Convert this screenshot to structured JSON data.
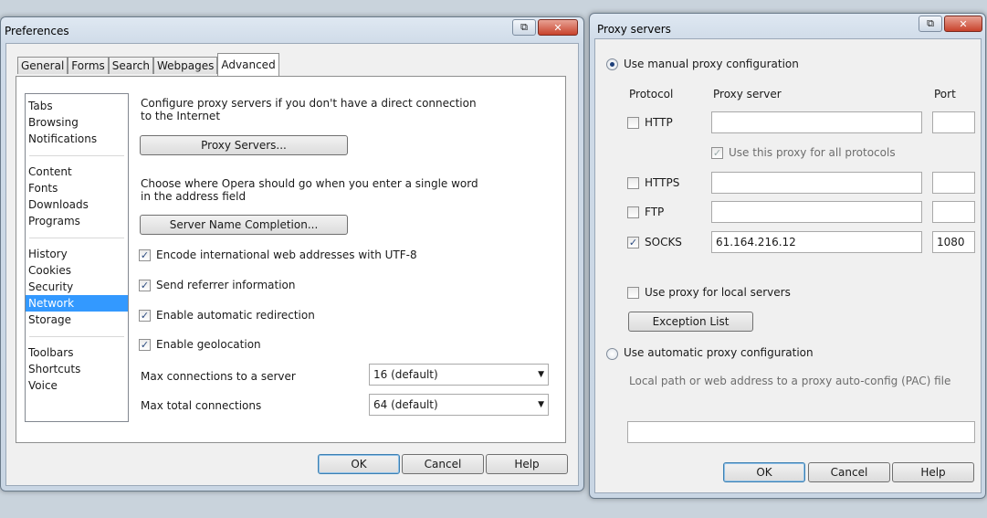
{
  "preferences": {
    "title": "Preferences",
    "tabs": [
      "General",
      "Forms",
      "Search",
      "Webpages",
      "Advanced"
    ],
    "active_tab": "Advanced",
    "categories": [
      [
        "Tabs",
        "Browsing",
        "Notifications"
      ],
      [
        "Content",
        "Fonts",
        "Downloads",
        "Programs"
      ],
      [
        "History",
        "Cookies",
        "Security",
        "Network",
        "Storage"
      ],
      [
        "Toolbars",
        "Shortcuts",
        "Voice"
      ]
    ],
    "selected_category": "Network",
    "proxy_desc": "Configure proxy servers if you don't have a direct connection to the Internet",
    "proxy_button": "Proxy Servers...",
    "completion_desc": "Choose where Opera should go when you enter a single word in the address field",
    "completion_button": "Server Name Completion...",
    "checks": [
      {
        "label": "Encode international web addresses with UTF-8",
        "checked": true
      },
      {
        "label": "Send referrer information",
        "checked": true
      },
      {
        "label": "Enable automatic redirection",
        "checked": true
      },
      {
        "label": "Enable geolocation",
        "checked": true
      }
    ],
    "max_server_label": "Max connections to a server",
    "max_server_value": "16 (default)",
    "max_total_label": "Max total connections",
    "max_total_value": "64 (default)",
    "ok": "OK",
    "cancel": "Cancel",
    "help": "Help"
  },
  "proxy": {
    "title": "Proxy servers",
    "manual_label": "Use manual proxy configuration",
    "manual_selected": true,
    "col_protocol": "Protocol",
    "col_server": "Proxy server",
    "col_port": "Port",
    "rows": [
      {
        "protocol": "HTTP",
        "checked": false,
        "server": "",
        "port": ""
      },
      {
        "protocol": "HTTPS",
        "checked": false,
        "server": "",
        "port": ""
      },
      {
        "protocol": "FTP",
        "checked": false,
        "server": "",
        "port": ""
      },
      {
        "protocol": "SOCKS",
        "checked": true,
        "server": "61.164.216.12",
        "port": "1080"
      }
    ],
    "use_all_label": "Use this proxy for all protocols",
    "local_label": "Use proxy for local servers",
    "exception_button": "Exception List",
    "auto_label": "Use automatic proxy configuration",
    "auto_desc": "Local path or web address to a proxy auto-config (PAC) file",
    "pac_value": "",
    "ok": "OK",
    "cancel": "Cancel",
    "help": "Help"
  }
}
